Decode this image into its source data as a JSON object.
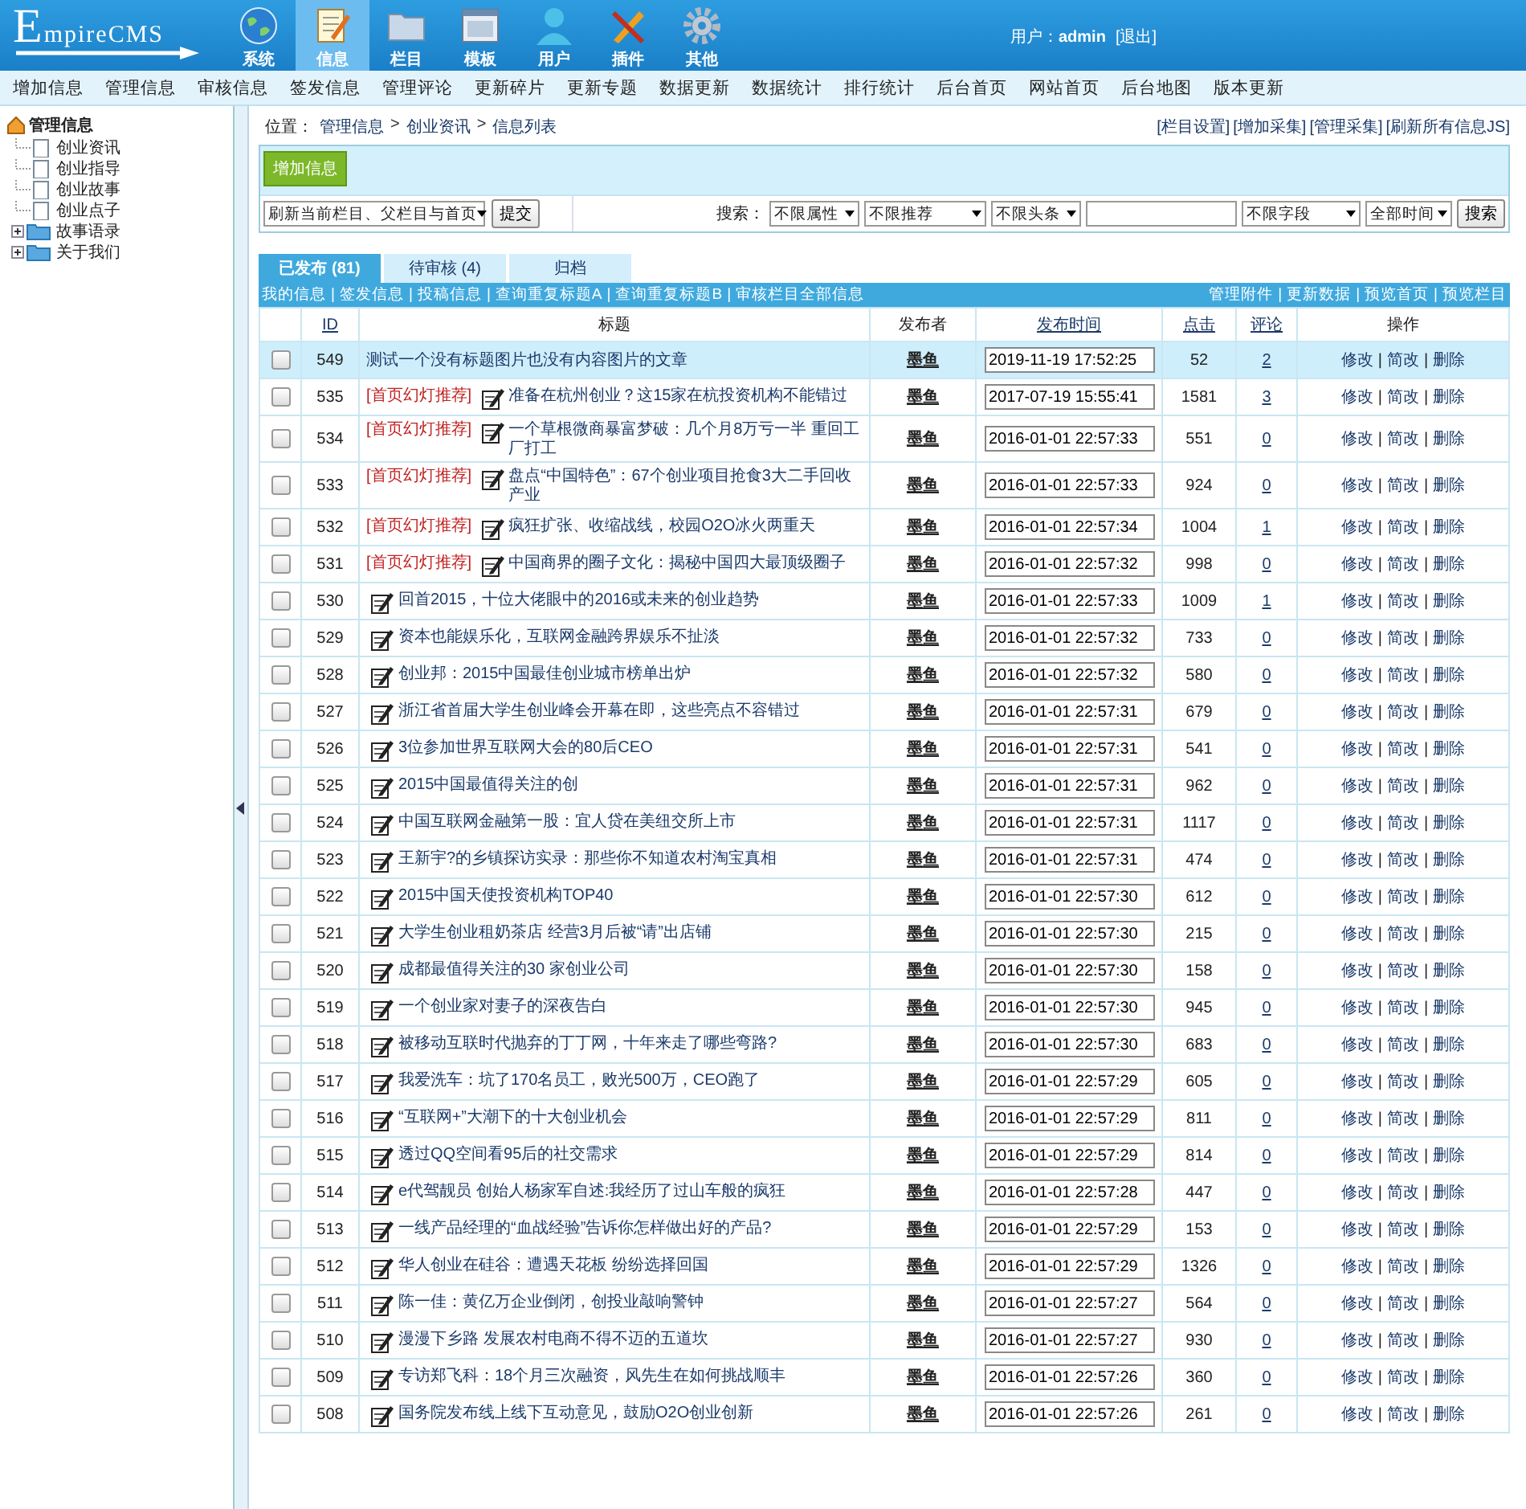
{
  "header": {
    "logo": "EmpireCMS",
    "nav": [
      {
        "label": "系统",
        "kind": "globe",
        "selected": false
      },
      {
        "label": "信息",
        "kind": "notepad",
        "selected": true
      },
      {
        "label": "栏目",
        "kind": "folder",
        "selected": false
      },
      {
        "label": "模板",
        "kind": "window",
        "selected": false
      },
      {
        "label": "用户",
        "kind": "user",
        "selected": false
      },
      {
        "label": "插件",
        "kind": "tools",
        "selected": false
      },
      {
        "label": "其他",
        "kind": "gear",
        "selected": false
      }
    ],
    "user_label": "用户：",
    "user": "admin",
    "logout": "[退出]"
  },
  "menu": [
    "增加信息",
    "管理信息",
    "审核信息",
    "签发信息",
    "管理评论",
    "更新碎片",
    "更新专题",
    "数据更新",
    "数据统计",
    "排行统计",
    "后台首页",
    "网站首页",
    "后台地图",
    "版本更新"
  ],
  "tree": {
    "root": "管理信息",
    "items": [
      {
        "label": "创业资讯",
        "kind": "page"
      },
      {
        "label": "创业指导",
        "kind": "page"
      },
      {
        "label": "创业故事",
        "kind": "page"
      },
      {
        "label": "创业点子",
        "kind": "page"
      },
      {
        "label": "故事语录",
        "kind": "folder",
        "expanded": false
      },
      {
        "label": "关于我们",
        "kind": "folder",
        "expanded": false
      }
    ]
  },
  "breadcrumb": {
    "label": "位置：",
    "links": [
      "管理信息",
      "创业资讯",
      "信息列表"
    ],
    "separator": ">"
  },
  "top_links": [
    "[栏目设置]",
    "[增加采集]",
    "[管理采集]",
    "[刷新所有信息JS]"
  ],
  "add_button": "增加信息",
  "refresh_select": "刷新当前栏目、父栏目与首页",
  "submit_button": "提交",
  "search": {
    "label": "搜索：",
    "selects": [
      "不限属性",
      "不限推荐",
      "不限头条"
    ],
    "field_select": "不限字段",
    "time_select": "全部时间",
    "button": "搜索"
  },
  "tabs": [
    {
      "label": "已发布 (81)",
      "selected": true
    },
    {
      "label": "待审核 (4)",
      "selected": false
    },
    {
      "label": "归档",
      "selected": false
    }
  ],
  "bar_links_left": [
    "我的信息",
    "签发信息",
    "投稿信息",
    "查询重复标题A",
    "查询重复标题B",
    "审核栏目全部信息"
  ],
  "bar_links_right": [
    "管理附件",
    "更新数据",
    "预览首页",
    "预览栏目"
  ],
  "link_separator": "|",
  "table": {
    "columns": [
      "ID",
      "标题",
      "发布者",
      "发布时间",
      "点击",
      "评论",
      "操作"
    ],
    "rows": [
      {
        "id": "549",
        "icon": false,
        "title": "测试一个没有标题图片也没有内容图片的文章",
        "publisher": "墨鱼",
        "time": "2019-11-19 17:52:25",
        "clicks": "52",
        "comments": "2",
        "actions": [
          "修改",
          "简改",
          "删除"
        ],
        "checked": false,
        "highlighted": true
      },
      {
        "id": "535",
        "flag": "[首页幻灯推荐]",
        "icon": true,
        "title": "准备在杭州创业？这15家在杭投资机构不能错过",
        "publisher": "墨鱼",
        "time": "2017-07-19 15:55:41",
        "clicks": "1581",
        "comments": "3",
        "actions": [
          "修改",
          "简改",
          "删除"
        ],
        "checked": false,
        "highlighted": false
      },
      {
        "id": "534",
        "flag": "[首页幻灯推荐]",
        "icon": true,
        "title": "一个草根微商暴富梦破：几个月8万亏一半 重回工厂打工",
        "publisher": "墨鱼",
        "time": "2016-01-01 22:57:33",
        "clicks": "551",
        "comments": "0",
        "actions": [
          "修改",
          "简改",
          "删除"
        ],
        "checked": false,
        "highlighted": false
      },
      {
        "id": "533",
        "flag": "[首页幻灯推荐]",
        "icon": true,
        "title": "盘点“中国特色”：67个创业项目抢食3大二手回收产业",
        "publisher": "墨鱼",
        "time": "2016-01-01 22:57:33",
        "clicks": "924",
        "comments": "0",
        "actions": [
          "修改",
          "简改",
          "删除"
        ],
        "checked": false,
        "highlighted": false
      },
      {
        "id": "532",
        "flag": "[首页幻灯推荐]",
        "icon": true,
        "title": "疯狂扩张、收缩战线，校园O2O冰火两重天",
        "publisher": "墨鱼",
        "time": "2016-01-01 22:57:34",
        "clicks": "1004",
        "comments": "1",
        "actions": [
          "修改",
          "简改",
          "删除"
        ],
        "checked": false,
        "highlighted": false
      },
      {
        "id": "531",
        "flag": "[首页幻灯推荐]",
        "icon": true,
        "title": "中国商界的圈子文化：揭秘中国四大最顶级圈子",
        "publisher": "墨鱼",
        "time": "2016-01-01 22:57:32",
        "clicks": "998",
        "comments": "0",
        "actions": [
          "修改",
          "简改",
          "删除"
        ],
        "checked": false,
        "highlighted": false
      },
      {
        "id": "530",
        "icon": true,
        "title": "回首2015，十位大佬眼中的2016或未来的创业趋势",
        "publisher": "墨鱼",
        "time": "2016-01-01 22:57:33",
        "clicks": "1009",
        "comments": "1",
        "actions": [
          "修改",
          "简改",
          "删除"
        ],
        "checked": false,
        "highlighted": false
      },
      {
        "id": "529",
        "icon": true,
        "title": "资本也能娱乐化，互联网金融跨界娱乐不扯淡",
        "publisher": "墨鱼",
        "time": "2016-01-01 22:57:32",
        "clicks": "733",
        "comments": "0",
        "actions": [
          "修改",
          "简改",
          "删除"
        ],
        "checked": false,
        "highlighted": false
      },
      {
        "id": "528",
        "icon": true,
        "title": "创业邦：2015中国最佳创业城市榜单出炉",
        "publisher": "墨鱼",
        "time": "2016-01-01 22:57:32",
        "clicks": "580",
        "comments": "0",
        "actions": [
          "修改",
          "简改",
          "删除"
        ],
        "checked": false,
        "highlighted": false
      },
      {
        "id": "527",
        "icon": true,
        "title": "浙江省首届大学生创业峰会开幕在即，这些亮点不容错过",
        "publisher": "墨鱼",
        "time": "2016-01-01 22:57:31",
        "clicks": "679",
        "comments": "0",
        "actions": [
          "修改",
          "简改",
          "删除"
        ],
        "checked": false,
        "highlighted": false
      },
      {
        "id": "526",
        "icon": true,
        "title": "3位参加世界互联网大会的80后CEO",
        "publisher": "墨鱼",
        "time": "2016-01-01 22:57:31",
        "clicks": "541",
        "comments": "0",
        "actions": [
          "修改",
          "简改",
          "删除"
        ],
        "checked": false,
        "highlighted": false
      },
      {
        "id": "525",
        "icon": true,
        "title": "2015中国最值得关注的创",
        "publisher": "墨鱼",
        "time": "2016-01-01 22:57:31",
        "clicks": "962",
        "comments": "0",
        "actions": [
          "修改",
          "简改",
          "删除"
        ],
        "checked": false,
        "highlighted": false
      },
      {
        "id": "524",
        "icon": true,
        "title": "中国互联网金融第一股：宜人贷在美纽交所上市",
        "publisher": "墨鱼",
        "time": "2016-01-01 22:57:31",
        "clicks": "1117",
        "comments": "0",
        "actions": [
          "修改",
          "简改",
          "删除"
        ],
        "checked": false,
        "highlighted": false
      },
      {
        "id": "523",
        "icon": true,
        "title": "王新宇?的乡镇探访实录：那些你不知道农村淘宝真相",
        "publisher": "墨鱼",
        "time": "2016-01-01 22:57:31",
        "clicks": "474",
        "comments": "0",
        "actions": [
          "修改",
          "简改",
          "删除"
        ],
        "checked": false,
        "highlighted": false
      },
      {
        "id": "522",
        "icon": true,
        "title": "2015中国天使投资机构TOP40",
        "publisher": "墨鱼",
        "time": "2016-01-01 22:57:30",
        "clicks": "612",
        "comments": "0",
        "actions": [
          "修改",
          "简改",
          "删除"
        ],
        "checked": false,
        "highlighted": false
      },
      {
        "id": "521",
        "icon": true,
        "title": "大学生创业租奶茶店 经营3月后被“请”出店铺",
        "publisher": "墨鱼",
        "time": "2016-01-01 22:57:30",
        "clicks": "215",
        "comments": "0",
        "actions": [
          "修改",
          "简改",
          "删除"
        ],
        "checked": false,
        "highlighted": false
      },
      {
        "id": "520",
        "icon": true,
        "title": "成都最值得关注的30 家创业公司",
        "publisher": "墨鱼",
        "time": "2016-01-01 22:57:30",
        "clicks": "158",
        "comments": "0",
        "actions": [
          "修改",
          "简改",
          "删除"
        ],
        "checked": false,
        "highlighted": false
      },
      {
        "id": "519",
        "icon": true,
        "title": "一个创业家对妻子的深夜告白",
        "publisher": "墨鱼",
        "time": "2016-01-01 22:57:30",
        "clicks": "945",
        "comments": "0",
        "actions": [
          "修改",
          "简改",
          "删除"
        ],
        "checked": false,
        "highlighted": false
      },
      {
        "id": "518",
        "icon": true,
        "title": "被移动互联时代抛弃的丁丁网，十年来走了哪些弯路?",
        "publisher": "墨鱼",
        "time": "2016-01-01 22:57:30",
        "clicks": "683",
        "comments": "0",
        "actions": [
          "修改",
          "简改",
          "删除"
        ],
        "checked": false,
        "highlighted": false
      },
      {
        "id": "517",
        "icon": true,
        "title": "我爱洗车：坑了170名员工，败光500万，CEO跑了",
        "publisher": "墨鱼",
        "time": "2016-01-01 22:57:29",
        "clicks": "605",
        "comments": "0",
        "actions": [
          "修改",
          "简改",
          "删除"
        ],
        "checked": false,
        "highlighted": false
      },
      {
        "id": "516",
        "icon": true,
        "title": "“互联网+”大潮下的十大创业机会",
        "publisher": "墨鱼",
        "time": "2016-01-01 22:57:29",
        "clicks": "811",
        "comments": "0",
        "actions": [
          "修改",
          "简改",
          "删除"
        ],
        "checked": false,
        "highlighted": false
      },
      {
        "id": "515",
        "icon": true,
        "title": "透过QQ空间看95后的社交需求",
        "publisher": "墨鱼",
        "time": "2016-01-01 22:57:29",
        "clicks": "814",
        "comments": "0",
        "actions": [
          "修改",
          "简改",
          "删除"
        ],
        "checked": false,
        "highlighted": false
      },
      {
        "id": "514",
        "icon": true,
        "title": "e代驾靓员 创始人杨家军自述:我经历了过山车般的疯狂",
        "publisher": "墨鱼",
        "time": "2016-01-01 22:57:28",
        "clicks": "447",
        "comments": "0",
        "actions": [
          "修改",
          "简改",
          "删除"
        ],
        "checked": false,
        "highlighted": false
      },
      {
        "id": "513",
        "icon": true,
        "title": "一线产品经理的“血战经验”告诉你怎样做出好的产品?",
        "publisher": "墨鱼",
        "time": "2016-01-01 22:57:29",
        "clicks": "153",
        "comments": "0",
        "actions": [
          "修改",
          "简改",
          "删除"
        ],
        "checked": false,
        "highlighted": false
      },
      {
        "id": "512",
        "icon": true,
        "title": "华人创业在硅谷：遭遇天花板 纷纷选择回国",
        "publisher": "墨鱼",
        "time": "2016-01-01 22:57:29",
        "clicks": "1326",
        "comments": "0",
        "actions": [
          "修改",
          "简改",
          "删除"
        ],
        "checked": false,
        "highlighted": false
      },
      {
        "id": "511",
        "icon": true,
        "title": "陈一佳：黄亿万企业倒闭，创投业敲响警钟",
        "publisher": "墨鱼",
        "time": "2016-01-01 22:57:27",
        "clicks": "564",
        "comments": "0",
        "actions": [
          "修改",
          "简改",
          "删除"
        ],
        "checked": false,
        "highlighted": false
      },
      {
        "id": "510",
        "icon": true,
        "title": "漫漫下乡路 发展农村电商不得不迈的五道坎",
        "publisher": "墨鱼",
        "time": "2016-01-01 22:57:27",
        "clicks": "930",
        "comments": "0",
        "actions": [
          "修改",
          "简改",
          "删除"
        ],
        "checked": false,
        "highlighted": false
      },
      {
        "id": "509",
        "icon": true,
        "title": "专访郑飞科：18个月三次融资，风先生在如何挑战顺丰",
        "publisher": "墨鱼",
        "time": "2016-01-01 22:57:26",
        "clicks": "360",
        "comments": "0",
        "actions": [
          "修改",
          "简改",
          "删除"
        ],
        "checked": false,
        "highlighted": false
      },
      {
        "id": "508",
        "icon": true,
        "title": "国务院发布线上线下互动意见，鼓励O2O创业创新",
        "publisher": "墨鱼",
        "time": "2016-01-01 22:57:26",
        "clicks": "261",
        "comments": "0",
        "actions": [
          "修改",
          "简改",
          "删除"
        ],
        "checked": false,
        "highlighted": false
      }
    ]
  }
}
